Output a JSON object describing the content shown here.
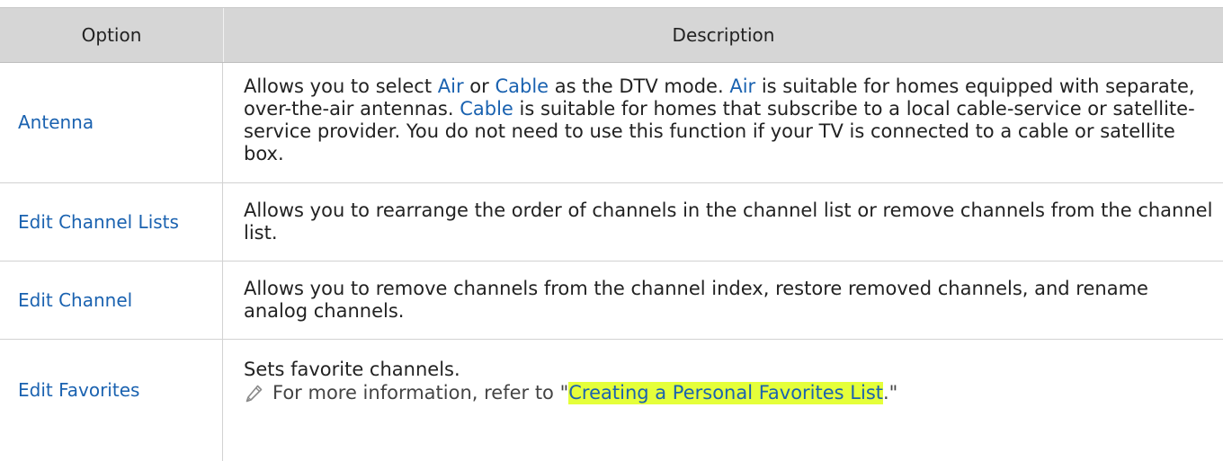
{
  "header": {
    "option": "Option",
    "description": "Description"
  },
  "rows": [
    {
      "option": "Antenna",
      "desc_p1": "Allows you to select ",
      "kw_air_1": "Air",
      "desc_p2": " or ",
      "kw_cable_1": "Cable",
      "desc_p3": " as the DTV mode. ",
      "kw_air_2": "Air",
      "desc_p4": " is suitable for homes equipped with separate, over-the-air antennas. ",
      "kw_cable_2": "Cable",
      "desc_p5": " is suitable for homes that subscribe to a local cable-service or satellite-service provider. You do not need to use this function if your TV is connected to a cable or satellite box."
    },
    {
      "option": "Edit Channel Lists",
      "description": "Allows you to rearrange the order of channels in the channel list or remove channels from the channel list."
    },
    {
      "option": "Edit Channel",
      "description": "Allows you to remove channels from the channel index, restore removed channels, and rename analog channels."
    },
    {
      "option": "Edit Favorites",
      "description": "Sets favorite channels.",
      "note_prefix": "For more information, refer to \"",
      "note_link": "Creating a Personal Favorites List",
      "note_suffix": ".\"",
      "note_icon": "pencil-icon"
    }
  ],
  "colors": {
    "header_bg": "#d6d6d6",
    "keyword": "#1a62b0",
    "highlight": "#e5ff3a",
    "border": "#d2d2d2"
  }
}
